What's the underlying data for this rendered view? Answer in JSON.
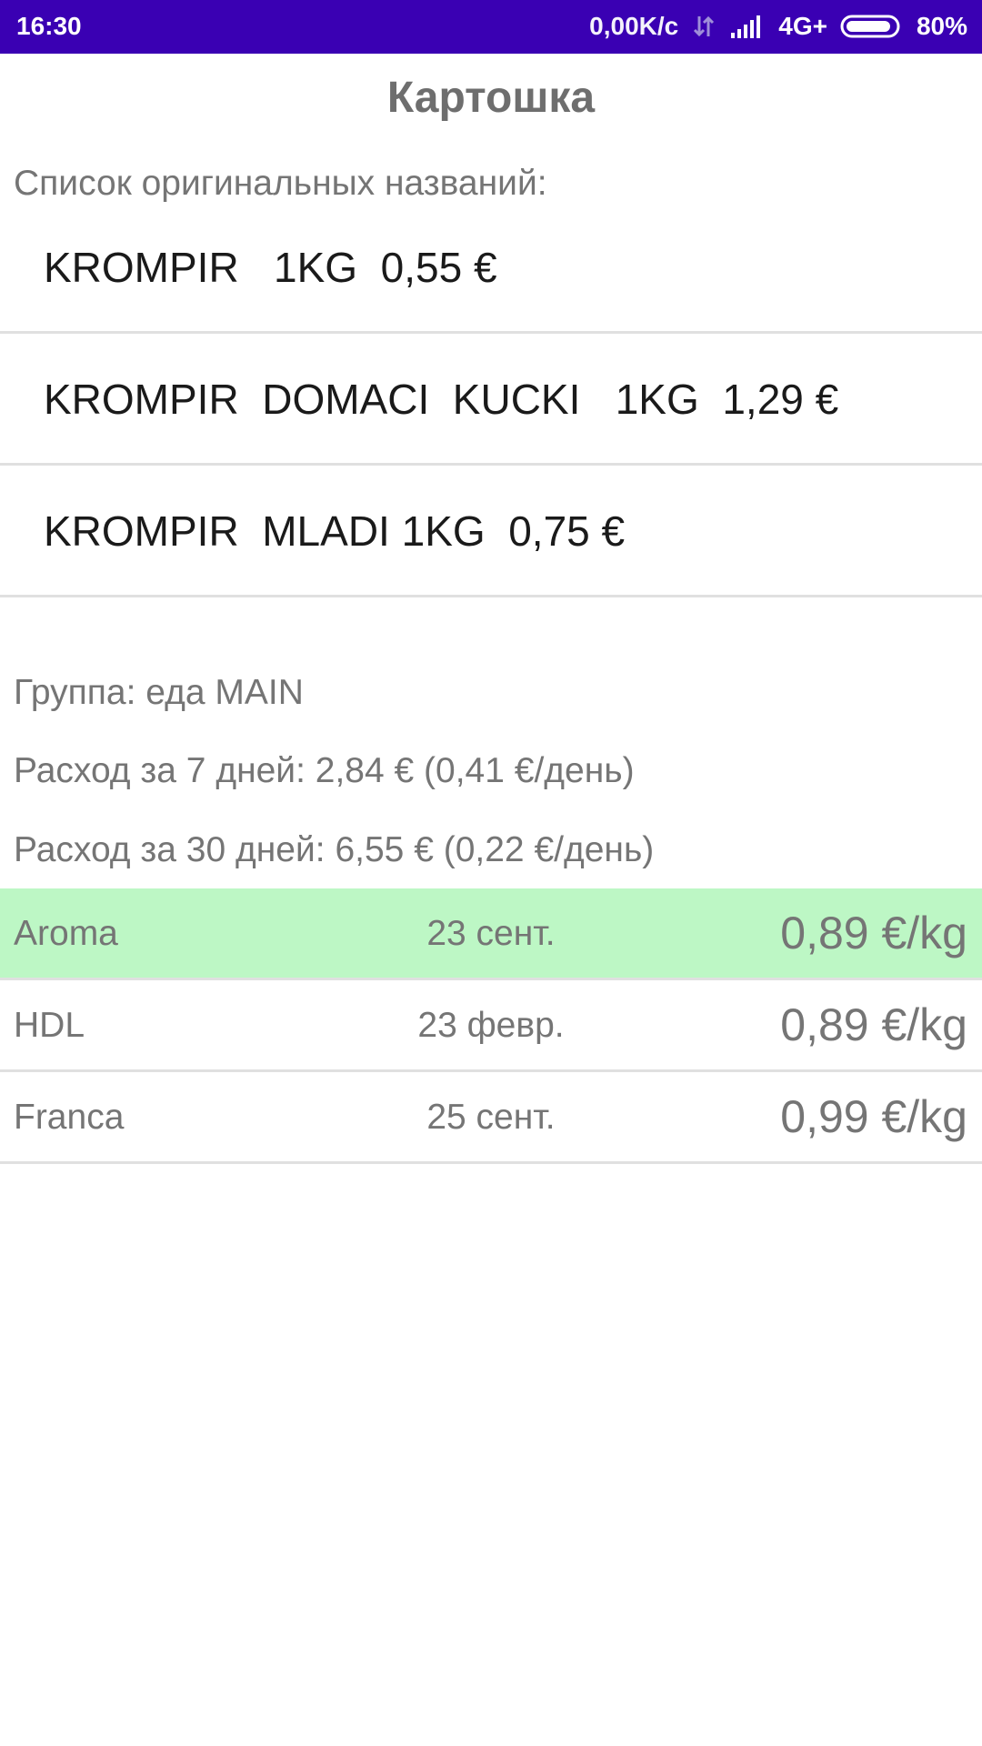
{
  "status_bar": {
    "time": "16:30",
    "speed": "0,00K/c",
    "network": "4G+",
    "battery": "80%",
    "icons": [
      "data-transfer-icon",
      "signal-icon",
      "battery-icon"
    ]
  },
  "title": "Картошка",
  "original_names": {
    "label": "Список оригинальных названий:",
    "items": [
      "KROMPIR   1KG  0,55 €",
      "KROMPIR  DOMACI  KUCKI   1KG  1,29 €",
      "KROMPIR  MLADI 1KG  0,75 €"
    ]
  },
  "info": {
    "group": "Группа: еда MAIN",
    "expense_7": "Расход за 7 дней: 2,84 € (0,41 €/день)",
    "expense_30": "Расход за 30 дней: 6,55 € (0,22 €/день)"
  },
  "prices": [
    {
      "store": "Aroma",
      "date": "23 сент.",
      "price": "0,89 €/kg",
      "highlight": true
    },
    {
      "store": "HDL",
      "date": "23 февр.",
      "price": "0,89 €/kg",
      "highlight": false
    },
    {
      "store": "Franca",
      "date": "25 сент.",
      "price": "0,99 €/kg",
      "highlight": false
    }
  ],
  "colors": {
    "status_bar": "#3a00b3",
    "highlight_row": "#bdf7c5",
    "divider": "#e0e0e0",
    "secondary_text": "#757575"
  }
}
